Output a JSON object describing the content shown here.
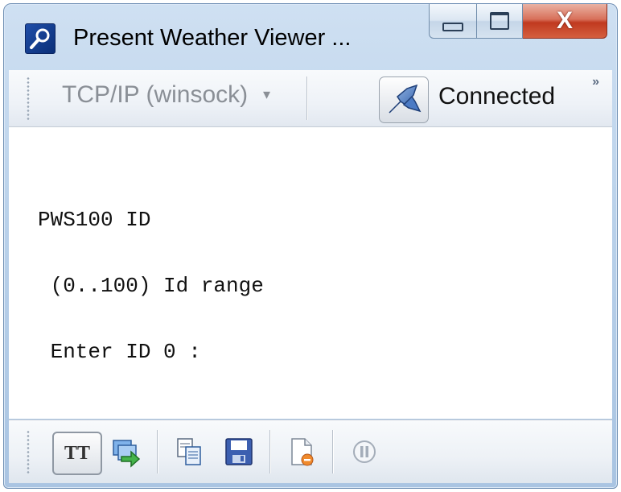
{
  "window": {
    "title": "Present Weather Viewer ...",
    "minimize_glyph": "minimize-icon",
    "maximize_glyph": "maximize-icon",
    "close_label": "X"
  },
  "toolbar": {
    "connection_type": "TCP/IP (winsock)",
    "connection_type_arrow": "▾",
    "status_label": "Connected",
    "overflow": "»"
  },
  "terminal": {
    "lines": [
      "PWS100 ID",
      " (0..100) Id range",
      " Enter ID 0 :"
    ]
  },
  "bottom_toolbar": {
    "tt_label": "TT",
    "buttons": [
      "text-mode-icon",
      "send-icon",
      "copy-icon",
      "save-icon",
      "clear-log-icon",
      "pause-icon"
    ]
  },
  "colors": {
    "window_frame": "#b9d1ea",
    "close_button": "#c0391f",
    "terminal_background": "#ffffff"
  }
}
